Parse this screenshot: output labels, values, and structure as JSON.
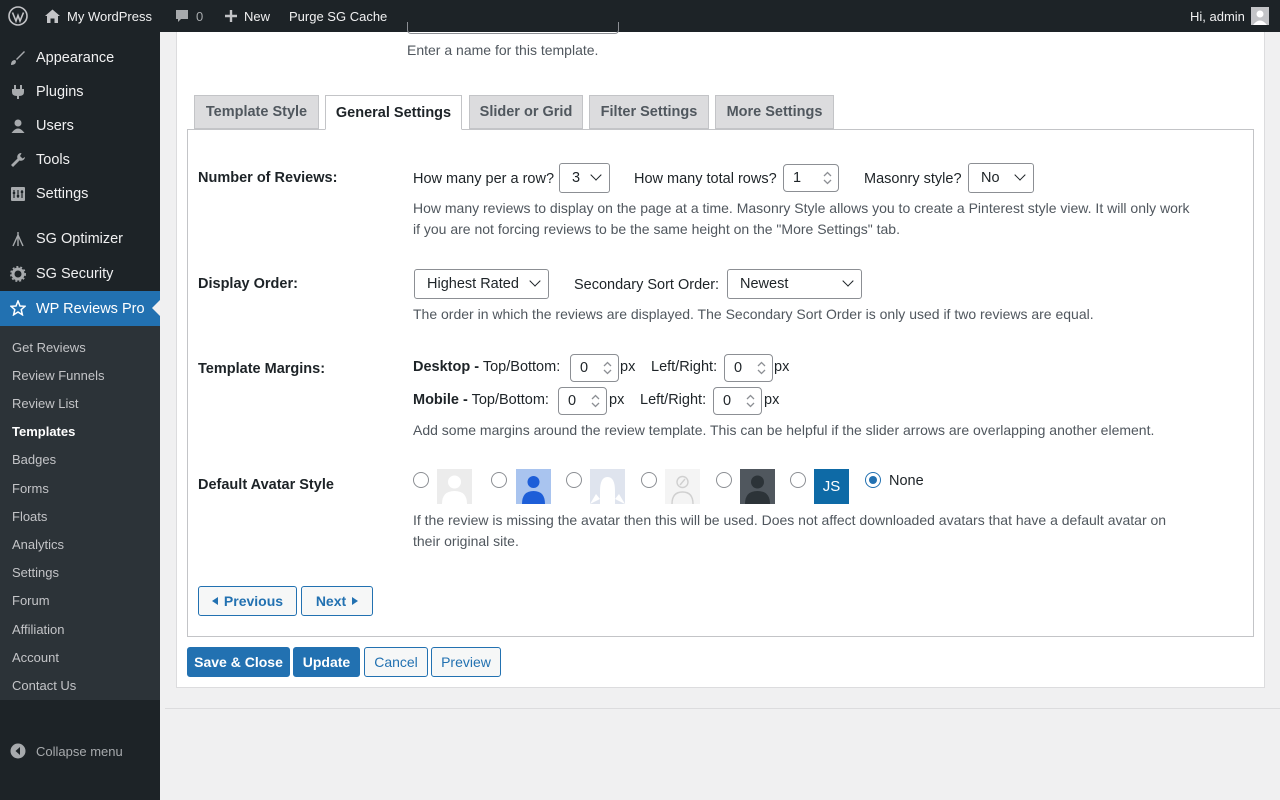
{
  "admin_bar": {
    "site_name": "My WordPress",
    "comments_count": "0",
    "new_label": "New",
    "purge_label": "Purge SG Cache",
    "greeting": "Hi, admin"
  },
  "sidebar": {
    "items": [
      {
        "label": "Appearance",
        "icon": "paintbrush-icon"
      },
      {
        "label": "Plugins",
        "icon": "plugin-icon"
      },
      {
        "label": "Users",
        "icon": "users-icon"
      },
      {
        "label": "Tools",
        "icon": "wrench-icon"
      },
      {
        "label": "Settings",
        "icon": "settings-icon"
      },
      {
        "label": "SG Optimizer",
        "icon": "sg-optimizer-icon"
      },
      {
        "label": "SG Security",
        "icon": "sg-security-icon"
      },
      {
        "label": "WP Reviews Pro",
        "icon": "star-icon"
      }
    ],
    "submenu": [
      "Get Reviews",
      "Review Funnels",
      "Review List",
      "Templates",
      "Badges",
      "Forms",
      "Floats",
      "Analytics",
      "Settings",
      "Forum",
      "Affiliation",
      "Account",
      "Contact Us"
    ],
    "current_submenu": "Templates",
    "collapse_label": "Collapse menu"
  },
  "template_name_hint": "Enter a name for this template.",
  "tabs": [
    {
      "label": "Template Style"
    },
    {
      "label": "General Settings"
    },
    {
      "label": "Slider or Grid"
    },
    {
      "label": "Filter Settings"
    },
    {
      "label": "More Settings"
    }
  ],
  "active_tab": "General Settings",
  "number_of_reviews": {
    "label": "Number of Reviews:",
    "per_row_label": "How many per a row?",
    "per_row_value": "3",
    "total_rows_label": "How many total rows?",
    "total_rows_value": "1",
    "masonry_label": "Masonry style?",
    "masonry_value": "No",
    "description_line1": "How many reviews to display on the page at a time. Masonry Style allows you to create a Pinterest style view. It will only work",
    "description_line2": "if you are not forcing reviews to be the same height on the \"More Settings\" tab."
  },
  "display_order": {
    "label": "Display Order:",
    "order_value": "Highest Rated",
    "secondary_label": "Secondary Sort Order:",
    "secondary_value": "Newest",
    "description": "The order in which the reviews are displayed. The Secondary Sort Order is only used if two reviews are equal."
  },
  "template_margins": {
    "label": "Template Margins:",
    "desktop_label": "Desktop -",
    "mobile_label": "Mobile -",
    "top_bottom_label": "Top/Bottom:",
    "left_right_label": "Left/Right:",
    "unit": "px",
    "desktop_top_bottom": "0",
    "desktop_left_right": "0",
    "mobile_top_bottom": "0",
    "mobile_left_right": "0",
    "description": "Add some margins around the review template. This can be helpful if the slider arrows are overlapping another element."
  },
  "default_avatar": {
    "label": "Default Avatar Style",
    "options": [
      "mystery-person-gray",
      "person-blue",
      "silhouette-light",
      "broken-image-light",
      "person-dark",
      "initials-js",
      "none"
    ],
    "initials": "JS",
    "none_label": "None",
    "selected": "none",
    "description_line1": "If the review is missing the avatar then this will be used. Does not affect downloaded avatars that have a default avatar on",
    "description_line2": "their original site."
  },
  "nav_buttons": {
    "previous": "Previous",
    "next": "Next"
  },
  "actions": {
    "save_close": "Save & Close",
    "update": "Update",
    "cancel": "Cancel",
    "preview": "Preview"
  },
  "colors": {
    "admin_dark": "#1d2327",
    "accent_blue": "#2271b1",
    "submenu_bg": "#2c3338"
  }
}
